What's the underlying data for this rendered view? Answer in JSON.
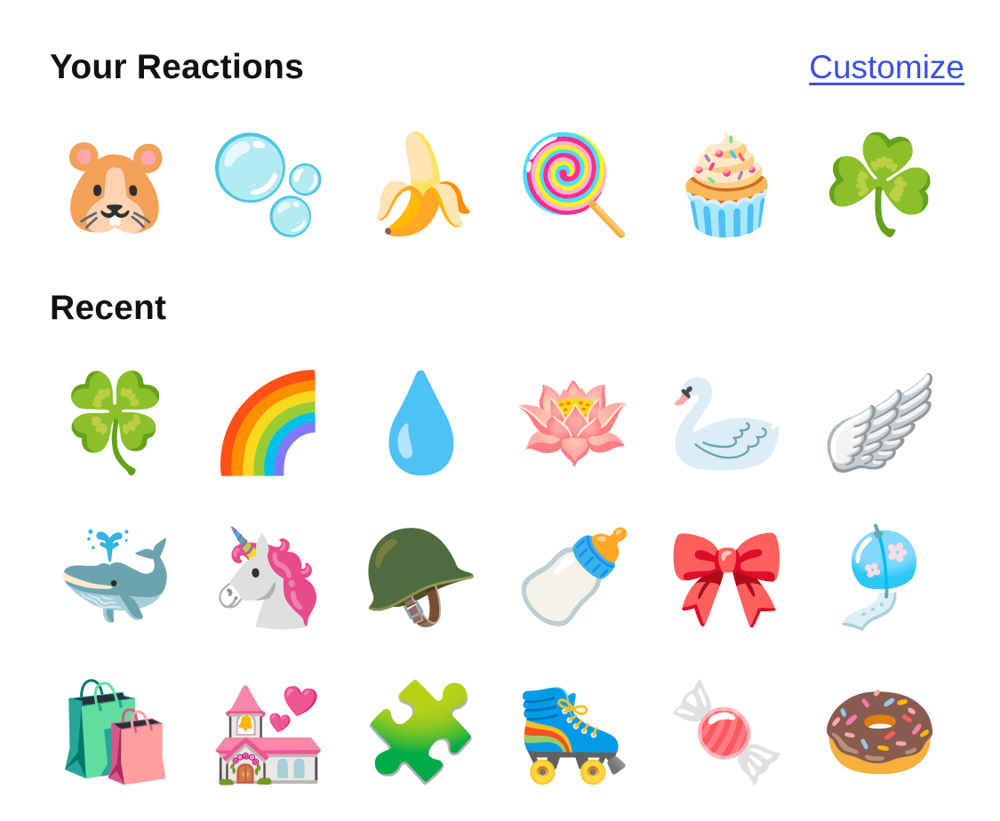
{
  "header": {
    "title": "Your Reactions",
    "customize_label": "Customize",
    "link_color": "#3b4fe4"
  },
  "reactions": [
    {
      "icon": "hamster-icon",
      "glyph": "🐹"
    },
    {
      "icon": "bubbles-icon",
      "glyph": "🫧"
    },
    {
      "icon": "banana-icon",
      "glyph": "🍌"
    },
    {
      "icon": "lollipop-icon",
      "glyph": "🍭"
    },
    {
      "icon": "cupcake-icon",
      "glyph": "🧁"
    },
    {
      "icon": "shamrock-icon",
      "glyph": "☘️"
    }
  ],
  "recent": {
    "title": "Recent",
    "items": [
      {
        "icon": "four-leaf-clover-icon",
        "glyph": "🍀"
      },
      {
        "icon": "rainbow-icon",
        "glyph": "🌈"
      },
      {
        "icon": "droplet-icon",
        "glyph": "💧"
      },
      {
        "icon": "lotus-icon",
        "glyph": "🪷"
      },
      {
        "icon": "swan-icon",
        "glyph": "🦢"
      },
      {
        "icon": "wing-icon",
        "glyph": "🪽"
      },
      {
        "icon": "spouting-whale-icon",
        "glyph": "🐳"
      },
      {
        "icon": "unicorn-icon",
        "glyph": "🦄"
      },
      {
        "icon": "military-helmet-icon",
        "glyph": "🪖"
      },
      {
        "icon": "baby-bottle-icon",
        "glyph": "🍼"
      },
      {
        "icon": "ribbon-bow-icon",
        "glyph": "🎀"
      },
      {
        "icon": "wind-chime-icon",
        "glyph": "🎐"
      },
      {
        "icon": "shopping-bags-icon",
        "glyph": "🛍️"
      },
      {
        "icon": "wedding-chapel-icon",
        "glyph": "💒"
      },
      {
        "icon": "puzzle-piece-icon",
        "glyph": "🧩"
      },
      {
        "icon": "roller-skate-icon",
        "glyph": "🛼"
      },
      {
        "icon": "candy-icon",
        "glyph": "🍬"
      },
      {
        "icon": "doughnut-icon",
        "glyph": "🍩"
      }
    ]
  }
}
